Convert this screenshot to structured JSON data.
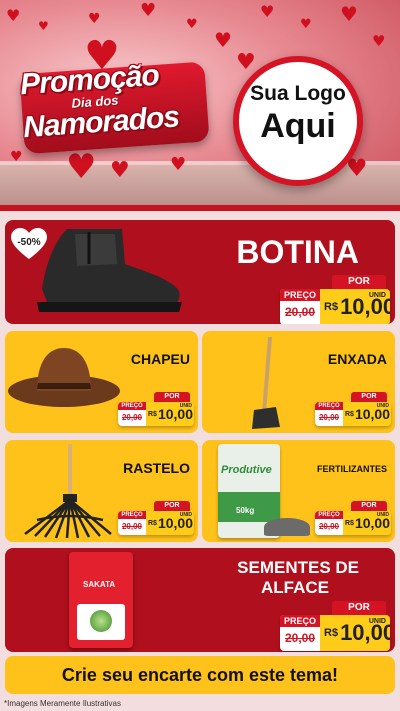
{
  "header": {
    "promo_line1": "Promoção",
    "promo_line2": "Dia dos",
    "promo_line3": "Namorados",
    "logo_line1": "Sua Logo",
    "logo_line2": "Aqui"
  },
  "price_labels": {
    "por": "POR",
    "preco": "PREÇO",
    "currency": "R$",
    "unit": "UNID"
  },
  "products": {
    "botina": {
      "name": "BOTINA",
      "discount": "-50%",
      "old_price": "20,00",
      "price": "10,00"
    },
    "chapeu": {
      "name": "CHAPEU",
      "old_price": "20,00",
      "price": "10,00"
    },
    "enxada": {
      "name": "ENXADA",
      "old_price": "20,00",
      "price": "10,00"
    },
    "rastelo": {
      "name": "RASTELO",
      "old_price": "20,00",
      "price": "10,00"
    },
    "fertilizantes": {
      "name": "FERTILIZANTES",
      "bag_brand": "Produtive",
      "bag_weight": "50kg",
      "old_price": "20,00",
      "price": "10,00"
    },
    "sementes": {
      "name_line1": "SEMENTES DE",
      "name_line2": "ALFACE",
      "pack_brand": "SAKATA",
      "old_price": "20,00",
      "price": "10,00"
    }
  },
  "cta": "Crie seu encarte com este tema!",
  "footnote": "*Imagens Meramente Ilustrativas",
  "colors": {
    "red": "#b0101d",
    "yellow": "#ffc21a",
    "accent": "#d41424"
  }
}
